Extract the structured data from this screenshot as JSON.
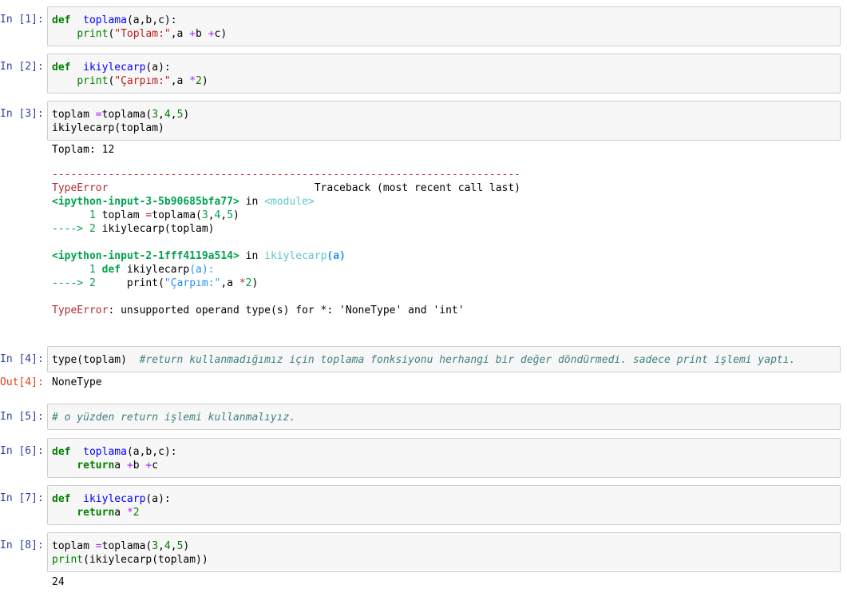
{
  "cells": [
    {
      "prompt": "In [1]:",
      "lines": [
        [
          [
            "kw",
            "def"
          ],
          [
            "",
            "  "
          ],
          [
            "fn",
            "toplama"
          ],
          [
            "",
            "(a,b,c):"
          ]
        ],
        [
          [
            "",
            "    "
          ],
          [
            "b",
            "print"
          ],
          [
            "",
            "("
          ],
          [
            "str",
            "\"Toplam:\""
          ],
          [
            "",
            ",a "
          ],
          [
            "op",
            "+"
          ],
          [
            "",
            ""
          ],
          [
            "",
            "b "
          ],
          [
            "op",
            "+"
          ],
          [
            "",
            ""
          ],
          [
            "",
            "c)"
          ]
        ]
      ]
    },
    {
      "prompt": "In [2]:",
      "lines": [
        [
          [
            "kw",
            "def"
          ],
          [
            "",
            "  "
          ],
          [
            "fn",
            "ikiylecarp"
          ],
          [
            "",
            "(a):"
          ]
        ],
        [
          [
            "",
            "    "
          ],
          [
            "b",
            "print"
          ],
          [
            "",
            "("
          ],
          [
            "str",
            "\"Çarpım:\""
          ],
          [
            "",
            ",a "
          ],
          [
            "op",
            "*"
          ],
          [
            "",
            ""
          ],
          [
            "num",
            "2"
          ],
          [
            "",
            ")"
          ]
        ]
      ]
    },
    {
      "prompt": "In [3]:",
      "lines": [
        [
          [
            "",
            "toplam "
          ],
          [
            "op",
            "="
          ],
          [
            "",
            ""
          ],
          [
            "",
            "toplama("
          ],
          [
            "num",
            "3"
          ],
          [
            "",
            ","
          ],
          [
            "num",
            "4"
          ],
          [
            "",
            ","
          ],
          [
            "num",
            "5"
          ],
          [
            "",
            ")"
          ]
        ],
        [
          [
            "",
            "ikiylecarp(toplam)"
          ]
        ]
      ]
    },
    {
      "prompt": "In [4]:",
      "lines": [
        [
          [
            "",
            "type(toplam)  "
          ],
          [
            "cmt",
            "#return kullanmadığımız için toplama fonksiyonu herhangi bir değer döndürmedi. sadece print işlemi yaptı."
          ]
        ]
      ]
    },
    {
      "prompt": "In [5]:",
      "lines": [
        [
          [
            "cmt",
            "# o yüzden return işlemi kullanmalıyız."
          ]
        ]
      ]
    },
    {
      "prompt": "In [6]:",
      "lines": [
        [
          [
            "kw",
            "def"
          ],
          [
            "",
            "  "
          ],
          [
            "fn",
            "toplama"
          ],
          [
            "",
            "(a,b,c):"
          ]
        ],
        [
          [
            "",
            "    "
          ],
          [
            "kw",
            "return"
          ],
          [
            "",
            ""
          ],
          [
            "",
            ""
          ],
          [
            "",
            "a "
          ],
          [
            "op",
            "+"
          ],
          [
            "",
            ""
          ],
          [
            "",
            "b "
          ],
          [
            "op",
            "+"
          ],
          [
            "",
            ""
          ],
          [
            "",
            "c"
          ]
        ]
      ]
    },
    {
      "prompt": "In [7]:",
      "lines": [
        [
          [
            "kw",
            "def"
          ],
          [
            "",
            "  "
          ],
          [
            "fn",
            "ikiylecarp"
          ],
          [
            "",
            "(a):"
          ]
        ],
        [
          [
            "",
            "    "
          ],
          [
            "kw",
            "return"
          ],
          [
            "",
            ""
          ],
          [
            "",
            ""
          ],
          [
            "",
            "a "
          ],
          [
            "op",
            "*"
          ],
          [
            "",
            ""
          ],
          [
            "num",
            "2"
          ]
        ]
      ]
    },
    {
      "prompt": "In [8]:",
      "lines": [
        [
          [
            "",
            "toplam "
          ],
          [
            "op",
            "="
          ],
          [
            "",
            ""
          ],
          [
            "",
            "toplama("
          ],
          [
            "num",
            "3"
          ],
          [
            "",
            ","
          ],
          [
            "num",
            "4"
          ],
          [
            "",
            ","
          ],
          [
            "num",
            "5"
          ],
          [
            "",
            ")"
          ]
        ],
        [
          [
            "b",
            "print"
          ],
          [
            "",
            "(ikiylecarp(toplam))"
          ]
        ]
      ]
    }
  ],
  "outputs": {
    "cell3_stdout": "Toplam: 12",
    "cell3_traceback": [
      [
        [
          "dash",
          "---------------------------------------------------------------------------"
        ]
      ],
      [
        [
          "tb-red",
          "TypeError"
        ],
        [
          "",
          "                                 Traceback (most recent call last)"
        ]
      ],
      [
        [
          "tb-green bold",
          "<ipython-input-3-5b90685bfa77>"
        ],
        [
          "",
          " in "
        ],
        [
          "tb-cyan",
          "<module>"
        ]
      ],
      [
        [
          "tb-green",
          "      1 "
        ],
        [
          "",
          "toplam "
        ],
        [
          "tb-red",
          "="
        ],
        [
          "",
          ""
        ],
        [
          "",
          "toplama("
        ],
        [
          "tb-green",
          "3"
        ],
        [
          "",
          ","
        ],
        [
          "tb-green",
          "4"
        ],
        [
          "",
          ","
        ],
        [
          "tb-green",
          "5"
        ],
        [
          "",
          ")"
        ]
      ],
      [
        [
          "tb-green",
          "----> 2 "
        ],
        [
          "",
          "ikiylecarp(toplam)"
        ]
      ],
      [
        [
          "",
          ""
        ]
      ],
      [
        [
          "tb-green bold",
          "<ipython-input-2-1fff4119a514>"
        ],
        [
          "",
          " in "
        ],
        [
          "tb-cyan",
          "ikiylecarp"
        ],
        [
          "tb-blue bold",
          "(a)"
        ]
      ],
      [
        [
          "tb-green",
          "      1 "
        ],
        [
          "tb-green bold",
          "def"
        ],
        [
          "",
          ""
        ],
        [
          "",
          " ikiylecarp"
        ],
        [
          "tb-blue",
          "(a):"
        ]
      ],
      [
        [
          "tb-green",
          "----> 2 "
        ],
        [
          "",
          "    print("
        ],
        [
          "tb-blue",
          "\"Çarpım:\""
        ],
        [
          "",
          ",a "
        ],
        [
          "tb-red",
          "*"
        ],
        [
          "",
          ""
        ],
        [
          "tb-green",
          "2"
        ],
        [
          "",
          ")"
        ]
      ],
      [
        [
          "",
          ""
        ]
      ],
      [
        [
          "tb-red",
          "TypeError"
        ],
        [
          "",
          ": unsupported operand type(s) for *: 'NoneType' and 'int'"
        ]
      ]
    ],
    "cell4_prompt": "Out[4]:",
    "cell4_result": "NoneType",
    "cell8_stdout": "24"
  }
}
